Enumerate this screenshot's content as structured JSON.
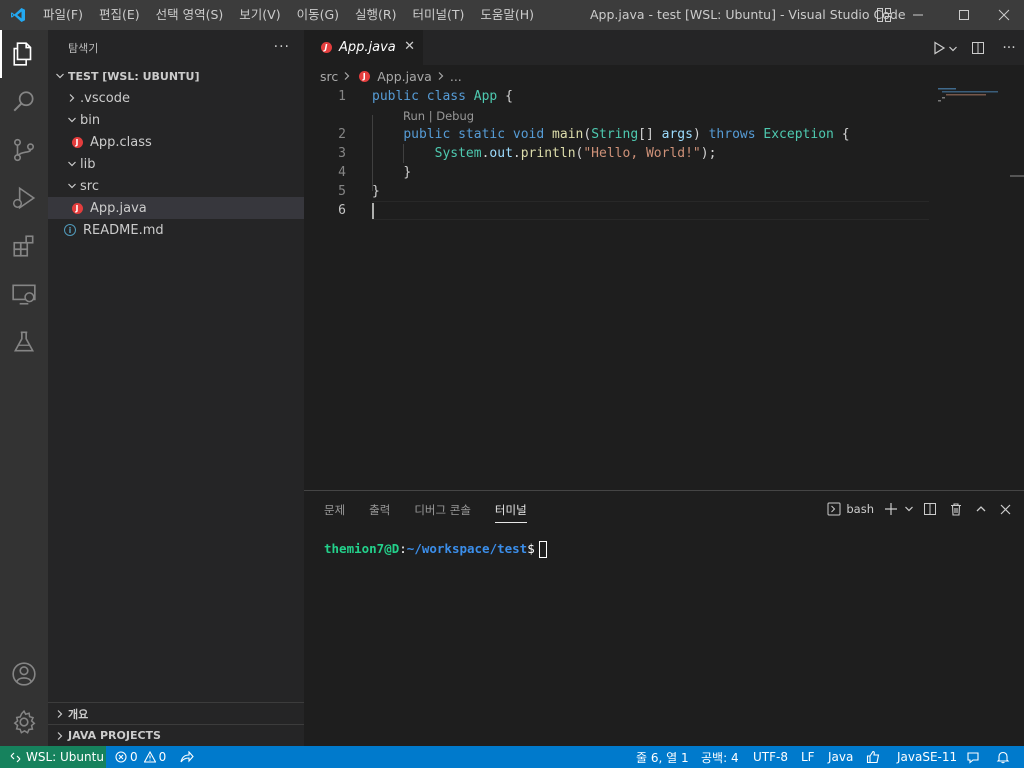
{
  "titlebar": {
    "menu": [
      "파일(F)",
      "편집(E)",
      "선택 영역(S)",
      "보기(V)",
      "이동(G)",
      "실행(R)",
      "터미널(T)",
      "도움말(H)"
    ],
    "title": "App.java - test [WSL: Ubuntu] - Visual Studio Code"
  },
  "activitybar": {
    "items": [
      "files-icon",
      "search-icon",
      "source-control-icon",
      "run-debug-icon",
      "extensions-icon",
      "remote-explorer-icon",
      "testing-icon"
    ],
    "bottom": [
      "account-icon",
      "manage-gear-icon"
    ]
  },
  "sidebar": {
    "title": "탐색기",
    "more": "···",
    "workspace": "TEST [WSL: UBUNTU]",
    "tree": [
      {
        "label": ".vscode",
        "kind": "folder",
        "expanded": false
      },
      {
        "label": "bin",
        "kind": "folder",
        "expanded": true
      },
      {
        "label": "App.class",
        "kind": "java-file"
      },
      {
        "label": "lib",
        "kind": "folder",
        "expanded": true
      },
      {
        "label": "src",
        "kind": "folder",
        "expanded": true
      },
      {
        "label": "App.java",
        "kind": "java-file",
        "selected": true
      },
      {
        "label": "README.md",
        "kind": "info-file"
      }
    ],
    "outline": "개요",
    "java_projects": "JAVA PROJECTS"
  },
  "editor": {
    "tab": "App.java",
    "breadcrumb": [
      "src",
      "App.java",
      "..."
    ],
    "codelens": "Run | Debug",
    "line_numbers": [
      "1",
      "2",
      "3",
      "4",
      "5",
      "6"
    ],
    "code": {
      "l1": [
        "public",
        "class",
        "App",
        "{"
      ],
      "l2": [
        "public",
        "static",
        "void",
        "main",
        "(",
        "String",
        "[] ",
        "args",
        ") ",
        "throws",
        "Exception",
        "{"
      ],
      "l3": [
        "System",
        ".",
        "out",
        ".",
        "println",
        "(",
        "\"Hello, World!\"",
        ");"
      ],
      "l4": [
        "}"
      ],
      "l5": [
        "}"
      ]
    }
  },
  "panel": {
    "tabs": [
      "문제",
      "출력",
      "디버그 콘솔",
      "터미널"
    ],
    "active_tab": "터미널",
    "shell": "bash",
    "prompt_user": "themion7@D",
    "prompt_sep": ":",
    "prompt_path": "~/workspace/test",
    "prompt_end": "$"
  },
  "statusbar": {
    "remote": "WSL: Ubuntu",
    "errors": "0",
    "warnings": "0",
    "position": "줄 6, 열 1",
    "spaces": "공백: 4",
    "encoding": "UTF-8",
    "eol": "LF",
    "language": "Java",
    "java_version": "JavaSE-11"
  },
  "colors": {
    "accent": "#007acc",
    "remote": "#16825d",
    "java_icon": "#e43d3d"
  }
}
